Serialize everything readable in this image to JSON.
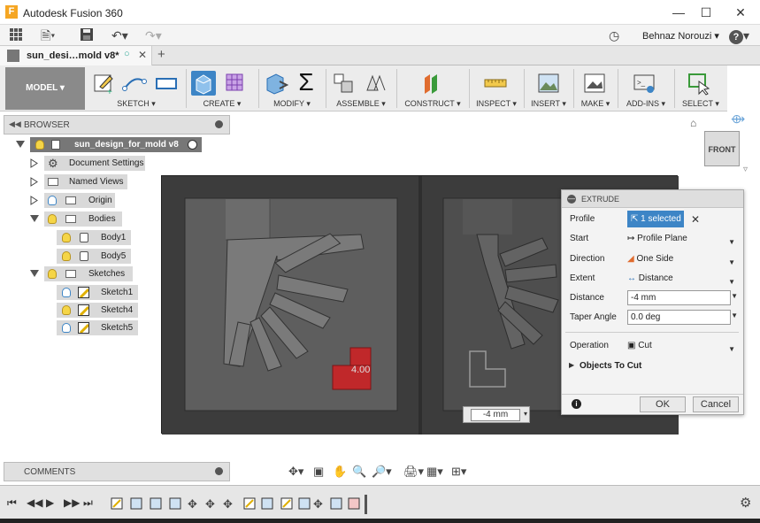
{
  "app": {
    "title": "Autodesk Fusion 360"
  },
  "user": {
    "name": "Behnaz Norouzi"
  },
  "document_tab": {
    "label": "sun_desi…mold v8*"
  },
  "ribbon": {
    "workspace": "MODEL",
    "groups": [
      "SKETCH",
      "CREATE",
      "MODIFY",
      "ASSEMBLE",
      "CONSTRUCT",
      "INSPECT",
      "INSERT",
      "MAKE",
      "ADD-INS",
      "SELECT"
    ]
  },
  "browser": {
    "title": "BROWSER",
    "root": "sun_design_for_mold v8",
    "items": [
      "Document Settings",
      "Named Views",
      "Origin",
      "Bodies",
      "Body1",
      "Body5",
      "Sketches",
      "Sketch1",
      "Sketch4",
      "Sketch5"
    ]
  },
  "viewcube": {
    "face": "FRONT"
  },
  "viewport": {
    "dim_label": "4.00",
    "distance_value": "-4 mm"
  },
  "extrude": {
    "title": "EXTRUDE",
    "profile_label": "Profile",
    "profile_value": "1 selected",
    "start_label": "Start",
    "start_value": "Profile Plane",
    "direction_label": "Direction",
    "direction_value": "One Side",
    "extent_label": "Extent",
    "extent_value": "Distance",
    "distance_label": "Distance",
    "distance_value": "-4 mm",
    "taper_label": "Taper Angle",
    "taper_value": "0.0 deg",
    "operation_label": "Operation",
    "operation_value": "Cut",
    "objects_label": "Objects To Cut",
    "ok_label": "OK",
    "cancel_label": "Cancel"
  },
  "comments": {
    "title": "COMMENTS"
  },
  "colors": {
    "accent": "#3d85c6",
    "cut_highlight": "#c0282a",
    "viewport": "#3b3b3b"
  }
}
